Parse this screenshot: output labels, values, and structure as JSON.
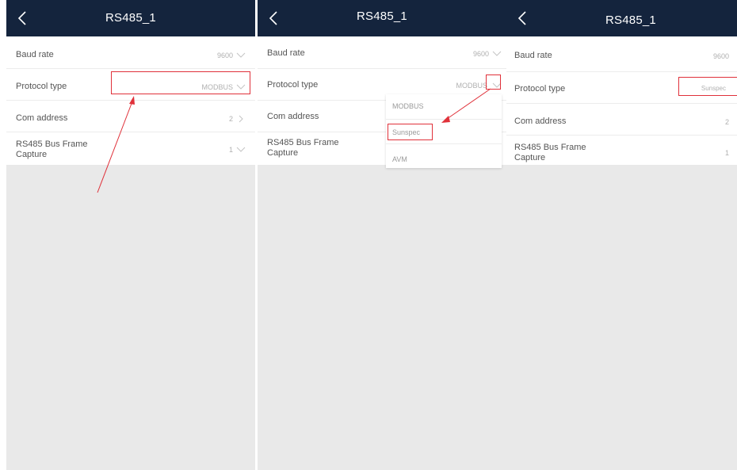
{
  "panels": [
    {
      "title": "RS485_1",
      "rows": [
        {
          "label": "Baud rate",
          "value": "9600"
        },
        {
          "label": "Protocol type",
          "value": "MODBUS"
        },
        {
          "label": "Com address",
          "value": "2"
        },
        {
          "label": "RS485 Bus Frame Capture",
          "value": "1"
        }
      ]
    },
    {
      "title": "RS485_1",
      "rows": [
        {
          "label": "Baud rate",
          "value": "9600"
        },
        {
          "label": "Protocol type",
          "value": "MODBUS"
        },
        {
          "label": "Com address",
          "value": ""
        },
        {
          "label": "RS485 Bus Frame Capture",
          "value": ""
        }
      ],
      "dropdown": [
        "MODBUS",
        "Sunspec",
        "AVM"
      ]
    },
    {
      "title": "RS485_1",
      "rows": [
        {
          "label": "Baud rate",
          "value": "9600"
        },
        {
          "label": "Protocol type",
          "value": "Sunspec"
        },
        {
          "label": "Com address",
          "value": "2"
        },
        {
          "label": "RS485 Bus Frame Capture",
          "value": "1"
        }
      ]
    }
  ],
  "colors": {
    "header": "#14243d",
    "highlight": "#e0313a",
    "background": "#e9e9e9"
  },
  "icons": {
    "back": "chevron-left-icon",
    "dropdown": "chevron-down-icon",
    "next": "chevron-right-icon"
  }
}
